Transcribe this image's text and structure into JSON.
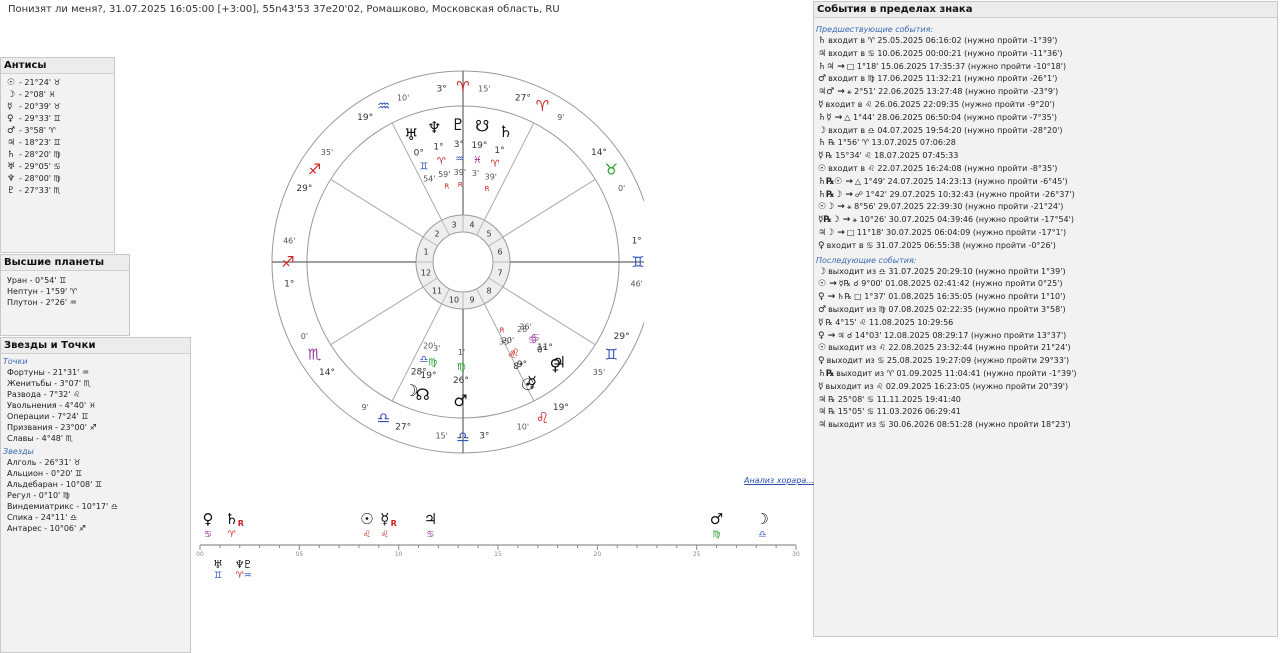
{
  "header": {
    "title": "Понизят ли меня?, 31.07.2025 16:05:00 [+3:00], 55n43'53 37e20'02, Ромашково, Московская область, RU"
  },
  "antiscia": {
    "title": "Антисы",
    "items": [
      {
        "sym": "☉",
        "text": "- 21°24' ♉"
      },
      {
        "sym": "☽",
        "text": "- 2°08' ♓"
      },
      {
        "sym": "☿",
        "text": "- 20°39' ♉"
      },
      {
        "sym": "♀",
        "text": "- 29°33' ♊"
      },
      {
        "sym": "♂",
        "text": "- 3°58' ♈"
      },
      {
        "sym": "♃",
        "text": "- 18°23' ♊"
      },
      {
        "sym": "♄",
        "text": "- 28°20' ♍"
      },
      {
        "sym": "♅",
        "text": "- 29°05' ♋"
      },
      {
        "sym": "♆",
        "text": "- 28°00' ♍"
      },
      {
        "sym": "♇",
        "text": "- 27°33' ♏"
      }
    ]
  },
  "higher": {
    "title": "Высшие планеты",
    "items": [
      "Уран - 0°54' ♊",
      "Нептун - 1°59' ♈",
      "Плутон - 2°26' ♒"
    ]
  },
  "stars": {
    "title": "Звезды и Точки",
    "points_label": "Точки",
    "points": [
      "Фортуны - 21°31' ♒",
      "Женитьбы - 3°07' ♏",
      "Развода - 7°32' ♌",
      "Увольнения - 4°40' ♓",
      "Операции - 7°24' ♊",
      "Призвания - 23°00' ♐",
      "Славы - 4°48' ♏"
    ],
    "stars_label": "Звезды",
    "stars": [
      "Алголь - 26°31' ♉",
      "Альцион - 0°20' ♊",
      "Альдебаран - 10°08' ♊",
      "Регул - 0°10' ♍",
      "Виндемиатрикс - 10°17' ♎",
      "Спика - 24°11' ♎",
      "Антарес - 10°06' ♐"
    ]
  },
  "events": {
    "title": "События в пределах знака",
    "before_label": "Предшествующие события:",
    "before": [
      {
        "sym": "♄",
        "text": "входит в ♈ 25.05.2025 06:16:02 (нужно пройти -1°39')"
      },
      {
        "sym": "♃",
        "text": "входит в ♋ 10.06.2025 00:00:21 (нужно пройти -11°36')"
      },
      {
        "sym": "♄♃ →",
        "text": "□ 1°18' 15.06.2025 17:35:37 (нужно пройти -10°18')"
      },
      {
        "sym": "♂",
        "text": "входит в ♍ 17.06.2025 11:32:21 (нужно пройти -26°1')"
      },
      {
        "sym": "♃♂ →",
        "text": "⚹ 2°51' 22.06.2025 13:27:48 (нужно пройти -23°9')"
      },
      {
        "sym": "☿",
        "text": "входит в ♌ 26.06.2025 22:09:35 (нужно пройти -9°20')"
      },
      {
        "sym": "♄☿ →",
        "text": "△ 1°44' 28.06.2025 06:50:04 (нужно пройти -7°35')"
      },
      {
        "sym": "☽",
        "text": "входит в ♎ 04.07.2025 19:54:20 (нужно пройти -28°20')"
      },
      {
        "sym": "♄",
        "text": "℞ 1°56' ♈ 13.07.2025 07:06:28"
      },
      {
        "sym": "☿",
        "text": "℞ 15°34' ♌ 18.07.2025 07:45:33"
      },
      {
        "sym": "☉",
        "text": "входит в ♌ 22.07.2025 16:24:08 (нужно пройти -8°35')"
      },
      {
        "sym": "♄℞☉ →",
        "text": "△ 1°49' 24.07.2025 14:23:13 (нужно пройти -6°45')"
      },
      {
        "sym": "♄℞☽ →",
        "text": "☍ 1°42' 29.07.2025 10:32:43 (нужно пройти -26°37')"
      },
      {
        "sym": "☉☽ →",
        "text": "⚹ 8°56' 29.07.2025 22:39:30 (нужно пройти -21°24')"
      },
      {
        "sym": "☿℞☽ →",
        "text": "⚹ 10°26' 30.07.2025 04:39:46 (нужно пройти -17°54')"
      },
      {
        "sym": "♃☽ →",
        "text": "□ 11°18' 30.07.2025 06:04:09 (нужно пройти -17°1')"
      },
      {
        "sym": "♀",
        "text": "входит в ♋ 31.07.2025 06:55:38 (нужно пройти -0°26')"
      }
    ],
    "after_label": "Последующие события:",
    "after": [
      {
        "sym": "☽",
        "text": "выходит из ♎ 31.07.2025 20:29:10 (нужно пройти 1°39')"
      },
      {
        "sym": "☉ →",
        "text": "☿℞ ☌ 9°00' 01.08.2025 02:41:42 (нужно пройти 0°25')"
      },
      {
        "sym": "♀ →",
        "text": "♄℞ □ 1°37' 01.08.2025 16:35:05 (нужно пройти 1°10')"
      },
      {
        "sym": "♂",
        "text": "выходит из ♍ 07.08.2025 02:22:35 (нужно пройти 3°58')"
      },
      {
        "sym": "☿",
        "text": "℞ 4°15' ♌ 11.08.2025 10:29:56"
      },
      {
        "sym": "♀ →",
        "text": "♃ ☌ 14°03' 12.08.2025 08:29:17 (нужно пройти 13°37')"
      },
      {
        "sym": "☉",
        "text": "выходит из ♌ 22.08.2025 23:32:44 (нужно пройти 21°24')"
      },
      {
        "sym": "♀",
        "text": "выходит из ♋ 25.08.2025 19:27:09 (нужно пройти 29°33')"
      },
      {
        "sym": "♄℞",
        "text": "выходит из ♈ 01.09.2025 11:04:41 (нужно пройти -1°39')"
      },
      {
        "sym": "☿",
        "text": "выходит из ♌ 02.09.2025 16:23:05 (нужно пройти 20°39')"
      },
      {
        "sym": "♃",
        "text": "℞ 25°08' ♋ 11.11.2025 19:41:40"
      },
      {
        "sym": "♃",
        "text": "℞ 15°05' ♋ 11.03.2026 06:29:41"
      },
      {
        "sym": "♃",
        "text": "выходит из ♋ 30.06.2026 08:51:28 (нужно пройти 18°23')"
      }
    ]
  },
  "analysis_link": "Анализ хорара...",
  "wheel": {
    "houses": [
      "1",
      "2",
      "3",
      "4",
      "5",
      "6",
      "7",
      "8",
      "9",
      "10",
      "11",
      "12"
    ],
    "cusps": [
      {
        "sign": "♐",
        "deg": "1°",
        "min": "46'",
        "color": "#cc2222"
      },
      {
        "sign": "♐",
        "deg": "29°",
        "min": "35'",
        "color": "#cc2222"
      },
      {
        "sign": "♒",
        "deg": "19°",
        "min": "10'",
        "color": "#3355bb"
      },
      {
        "sign": "♈",
        "deg": "3°",
        "min": "15'",
        "color": "#cc2222"
      },
      {
        "sign": "♈",
        "deg": "27°",
        "min": "9'",
        "color": "#cc2222"
      },
      {
        "sign": "♉",
        "deg": "14°",
        "min": "0'",
        "color": "#229922"
      },
      {
        "sign": "♊",
        "deg": "1°",
        "min": "46'",
        "color": "#3355bb"
      },
      {
        "sign": "♊",
        "deg": "29°",
        "min": "35'",
        "color": "#3355bb"
      },
      {
        "sign": "♌",
        "deg": "19°",
        "min": "10'",
        "color": "#cc2222"
      },
      {
        "sign": "♎",
        "deg": "3°",
        "min": "15'",
        "color": "#3355bb"
      },
      {
        "sign": "♎",
        "deg": "27°",
        "min": "9'",
        "color": "#3355bb"
      },
      {
        "sign": "♏",
        "deg": "14°",
        "min": "0'",
        "color": "#993399"
      }
    ],
    "planets": [
      {
        "sym": "☽",
        "deg": "28°",
        "sign": "♎",
        "min": "20'",
        "col": "#3355bb",
        "house": 10
      },
      {
        "sym": "♂",
        "deg": "26°",
        "sign": "♍",
        "min": "1'",
        "col": "#229922",
        "house": 9
      },
      {
        "sym": "☊",
        "deg": "19°",
        "sign": "♍",
        "min": "3'",
        "col": "#229922",
        "house": 9
      },
      {
        "sym": "☿",
        "deg": "9°",
        "sign": "♌",
        "min": "20'",
        "col": "#cc2222",
        "house": 8,
        "retro": "R"
      },
      {
        "sym": "☉",
        "deg": "8°",
        "sign": "♌",
        "min": "35'",
        "col": "#cc2222",
        "house": 8
      },
      {
        "sym": "♃",
        "deg": "11°",
        "sign": "♋",
        "min": "36'",
        "col": "#993399",
        "house": 8
      },
      {
        "sym": "♀",
        "deg": "0°",
        "sign": "♋",
        "min": "26'",
        "col": "#993399",
        "house": 8
      },
      {
        "sym": "♅",
        "deg": "0°",
        "sign": "♊",
        "min": "54'",
        "col": "#3355bb",
        "house": 3
      },
      {
        "sym": "♆",
        "deg": "1°",
        "sign": "♈",
        "min": "59'",
        "col": "#cc2222",
        "house": 3,
        "retro": "R"
      },
      {
        "sym": "♇",
        "deg": "3°",
        "sign": "♒",
        "min": "39'",
        "col": "#3355bb",
        "house": 3,
        "retro": "R"
      },
      {
        "sym": "☋",
        "deg": "19°",
        "sign": "♓",
        "min": "3'",
        "col": "#993399",
        "house": 3
      },
      {
        "sym": "♄",
        "deg": "1°",
        "sign": "♈",
        "min": "39'",
        "col": "#cc2222",
        "house": 3,
        "retro": "R"
      }
    ]
  },
  "strip": {
    "ticks": [
      "00",
      "05",
      "10",
      "15",
      "20",
      "25",
      "30"
    ],
    "ticks_minor": 30,
    "top": [
      {
        "sym": "♀",
        "val": 0.4,
        "sign": "♋",
        "col": "#993399"
      },
      {
        "sym": "♄",
        "val": 1.6,
        "sign": "♈",
        "col": "#cc2222",
        "retro": "R"
      },
      {
        "sym": "☉",
        "val": 8.4,
        "sign": "♌",
        "col": "#cc2222"
      },
      {
        "sym": "☿",
        "val": 9.3,
        "sign": "♌",
        "col": "#cc2222",
        "retro": "R"
      },
      {
        "sym": "♃",
        "val": 11.6,
        "sign": "♋",
        "col": "#993399"
      },
      {
        "sym": "♂",
        "val": 26.0,
        "sign": "♍",
        "col": "#229922"
      },
      {
        "sym": "☽",
        "val": 28.3,
        "sign": "♎",
        "col": "#3355bb"
      }
    ],
    "bottom": [
      {
        "sym": "♅",
        "val": 0.9,
        "sign": "♊",
        "col": "#3355bb"
      },
      {
        "sym": "♆",
        "val": 2.0,
        "sign": "♈",
        "col": "#cc2222"
      },
      {
        "sym": "♇",
        "val": 2.4,
        "sign": "♒",
        "col": "#3355bb"
      }
    ]
  }
}
